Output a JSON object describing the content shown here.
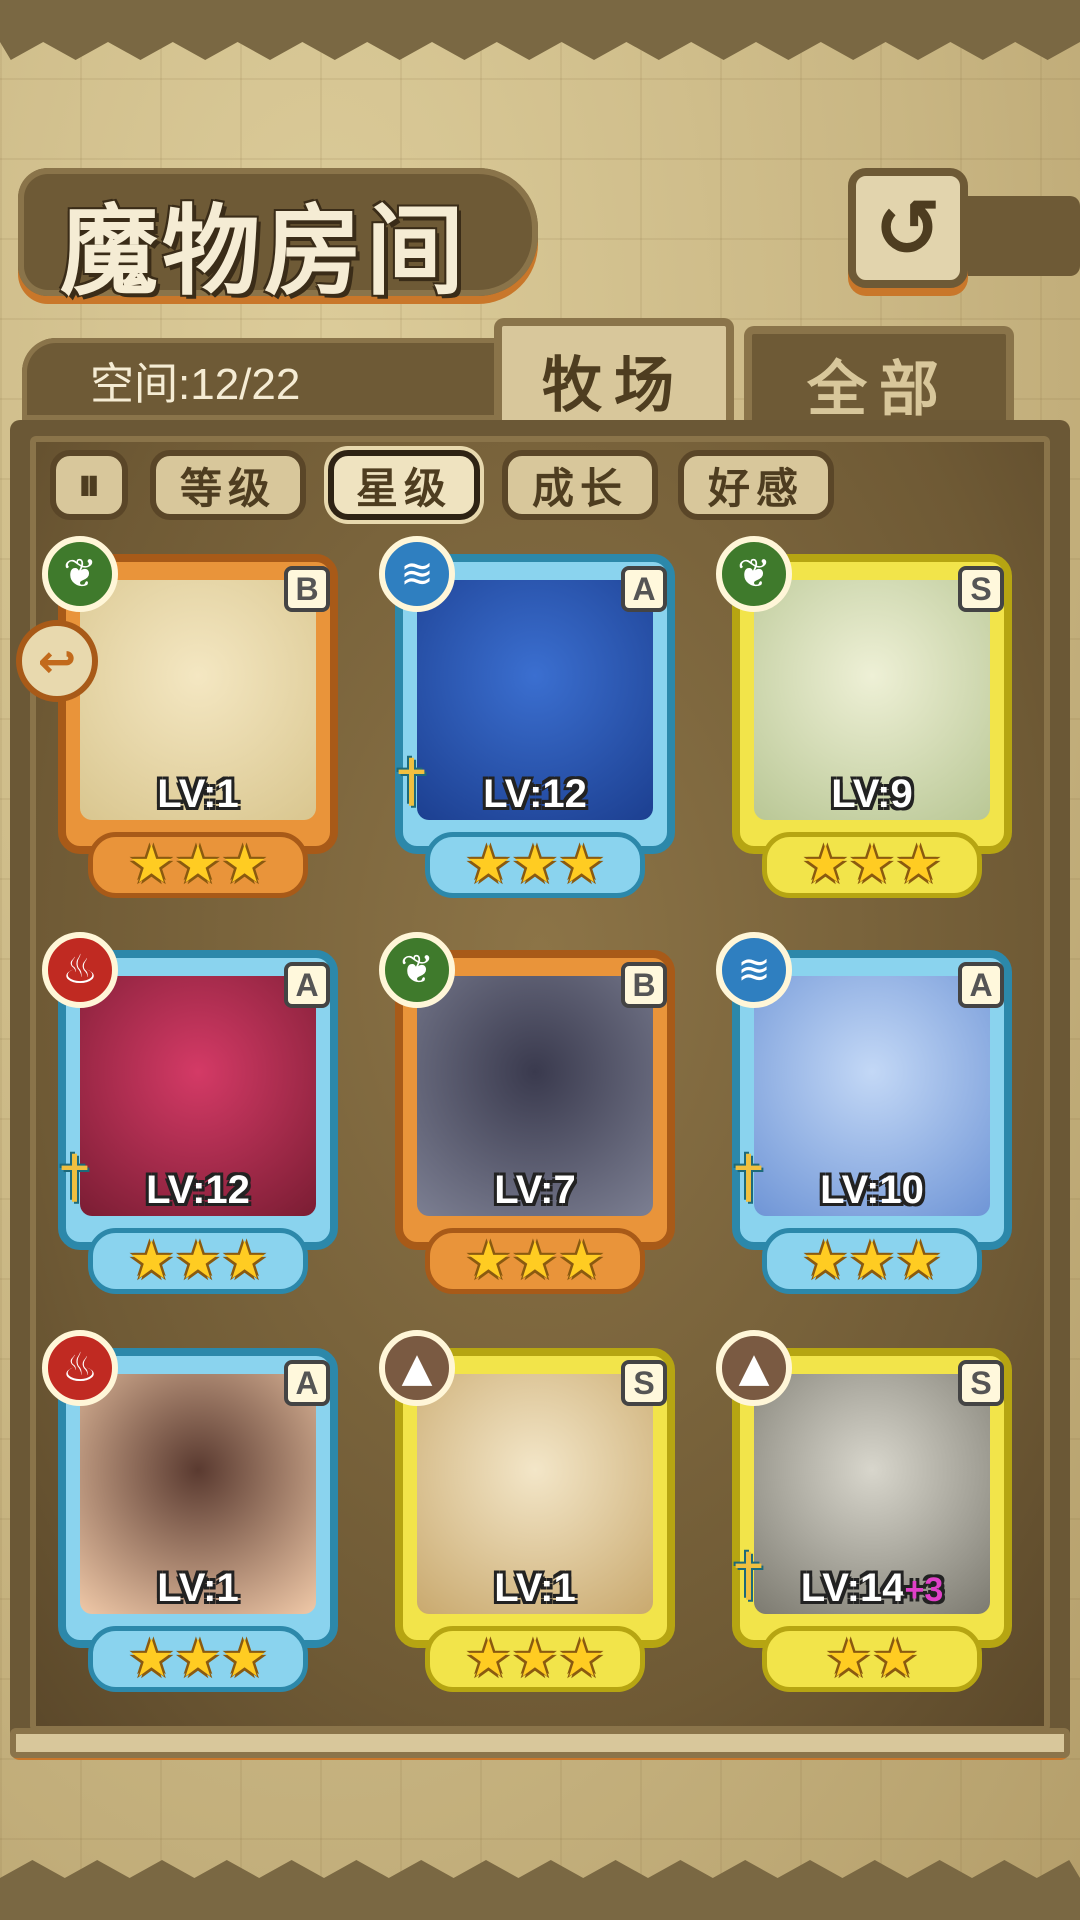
{
  "header": {
    "title": "魔物房间",
    "back_icon": "↺"
  },
  "space": {
    "label": "空间:12/22"
  },
  "tabs": [
    {
      "label": "牧场",
      "active": true
    },
    {
      "label": "全部",
      "active": false
    }
  ],
  "filters": {
    "sort_icon": "⏸",
    "items": [
      {
        "label": "等级",
        "active": false
      },
      {
        "label": "星级",
        "active": true
      },
      {
        "label": "成长",
        "active": false
      },
      {
        "label": "好感",
        "active": false
      }
    ]
  },
  "monsters": [
    {
      "rank": "B",
      "element": "plant-icon",
      "level": "LV:1",
      "plus": "",
      "stars": "★★★",
      "weapon": false,
      "portrait": [
        "#f4e7c2",
        "#d9c68f"
      ]
    },
    {
      "rank": "A",
      "element": "water-icon",
      "level": "LV:12",
      "plus": "",
      "stars": "★★★",
      "weapon": true,
      "portrait": [
        "#3b6fd0",
        "#1c3f90"
      ]
    },
    {
      "rank": "S",
      "element": "plant-icon",
      "level": "LV:9",
      "plus": "",
      "stars": "★★★",
      "weapon": false,
      "portrait": [
        "#eef0d6",
        "#b9c795"
      ]
    },
    {
      "rank": "A",
      "element": "fire-icon",
      "level": "LV:12",
      "plus": "",
      "stars": "★★★",
      "weapon": true,
      "portrait": [
        "#d43a66",
        "#7a1d33"
      ]
    },
    {
      "rank": "B",
      "element": "plant-icon",
      "level": "LV:7",
      "plus": "",
      "stars": "★★★",
      "weapon": false,
      "portrait": [
        "#3a3a4e",
        "#7c7f92"
      ]
    },
    {
      "rank": "A",
      "element": "water-icon",
      "level": "LV:10",
      "plus": "",
      "stars": "★★★",
      "weapon": true,
      "portrait": [
        "#c3d8f6",
        "#6f95d6"
      ]
    },
    {
      "rank": "A",
      "element": "fire-icon",
      "level": "LV:1",
      "plus": "",
      "stars": "★★★",
      "weapon": false,
      "portrait": [
        "#5a3a30",
        "#f0c9a8"
      ]
    },
    {
      "rank": "S",
      "element": "earth-icon",
      "level": "LV:1",
      "plus": "",
      "stars": "★★★",
      "weapon": false,
      "portrait": [
        "#f3e6c8",
        "#c9a96e"
      ]
    },
    {
      "rank": "S",
      "element": "earth-icon",
      "level": "LV:14",
      "plus": "+3",
      "stars": "★★",
      "weapon": true,
      "portrait": [
        "#d8d6cc",
        "#7c7a70"
      ]
    }
  ],
  "element_glyphs": {
    "plant-icon": "❦",
    "water-icon": "≋",
    "fire-icon": "♨",
    "earth-icon": "▲"
  },
  "weapon_glyph": "†",
  "side_arrow": "↩"
}
